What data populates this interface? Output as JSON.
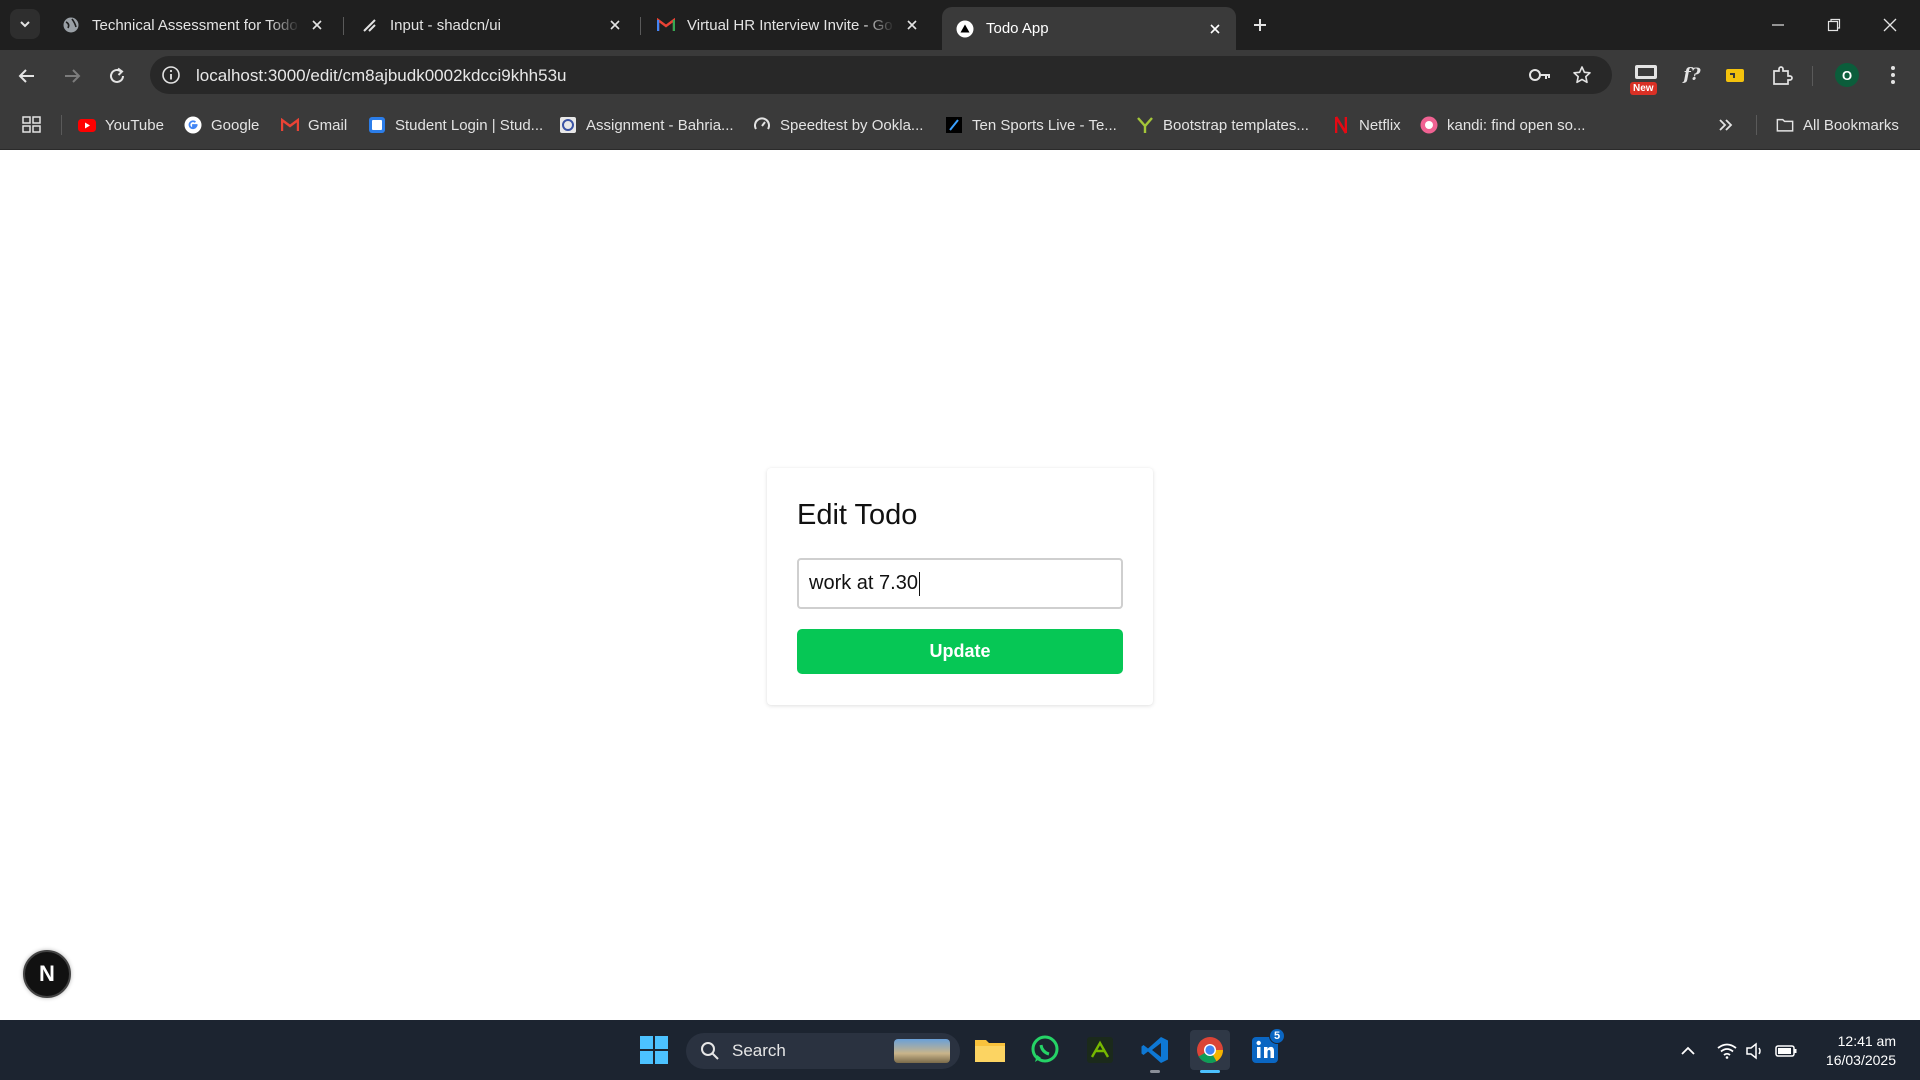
{
  "browser": {
    "tabs": [
      {
        "title": "Technical Assessment for Todo W",
        "active": false
      },
      {
        "title": "Input - shadcn/ui",
        "active": false
      },
      {
        "title": "Virtual HR Interview Invite - Go",
        "active": false
      },
      {
        "title": "Todo App",
        "active": true
      }
    ],
    "url": "localhost:3000/edit/cm8ajbudk0002kdcci9khh53u",
    "profile_initial": "O",
    "new_badge": "New",
    "bookmarks": [
      {
        "label": "YouTube"
      },
      {
        "label": "Google"
      },
      {
        "label": "Gmail"
      },
      {
        "label": "Student Login | Stud..."
      },
      {
        "label": "Assignment - Bahria..."
      },
      {
        "label": "Speedtest by Ookla..."
      },
      {
        "label": "Ten Sports Live - Te..."
      },
      {
        "label": "Bootstrap templates..."
      },
      {
        "label": "Netflix"
      },
      {
        "label": "kandi: find open so..."
      }
    ],
    "all_bookmarks": "All Bookmarks"
  },
  "page": {
    "card_title": "Edit Todo",
    "input_value": "work at 7.30",
    "update_label": "Update",
    "dev_badge": "N"
  },
  "taskbar": {
    "search_label": "Search",
    "linkedin_badge": "5",
    "time": "12:41 am",
    "date": "16/03/2025"
  },
  "colors": {
    "update_button": "#06c755",
    "tab_bar": "#1f1f1f",
    "toolbar": "#3a3a3a",
    "taskbar": "#1c2430"
  }
}
